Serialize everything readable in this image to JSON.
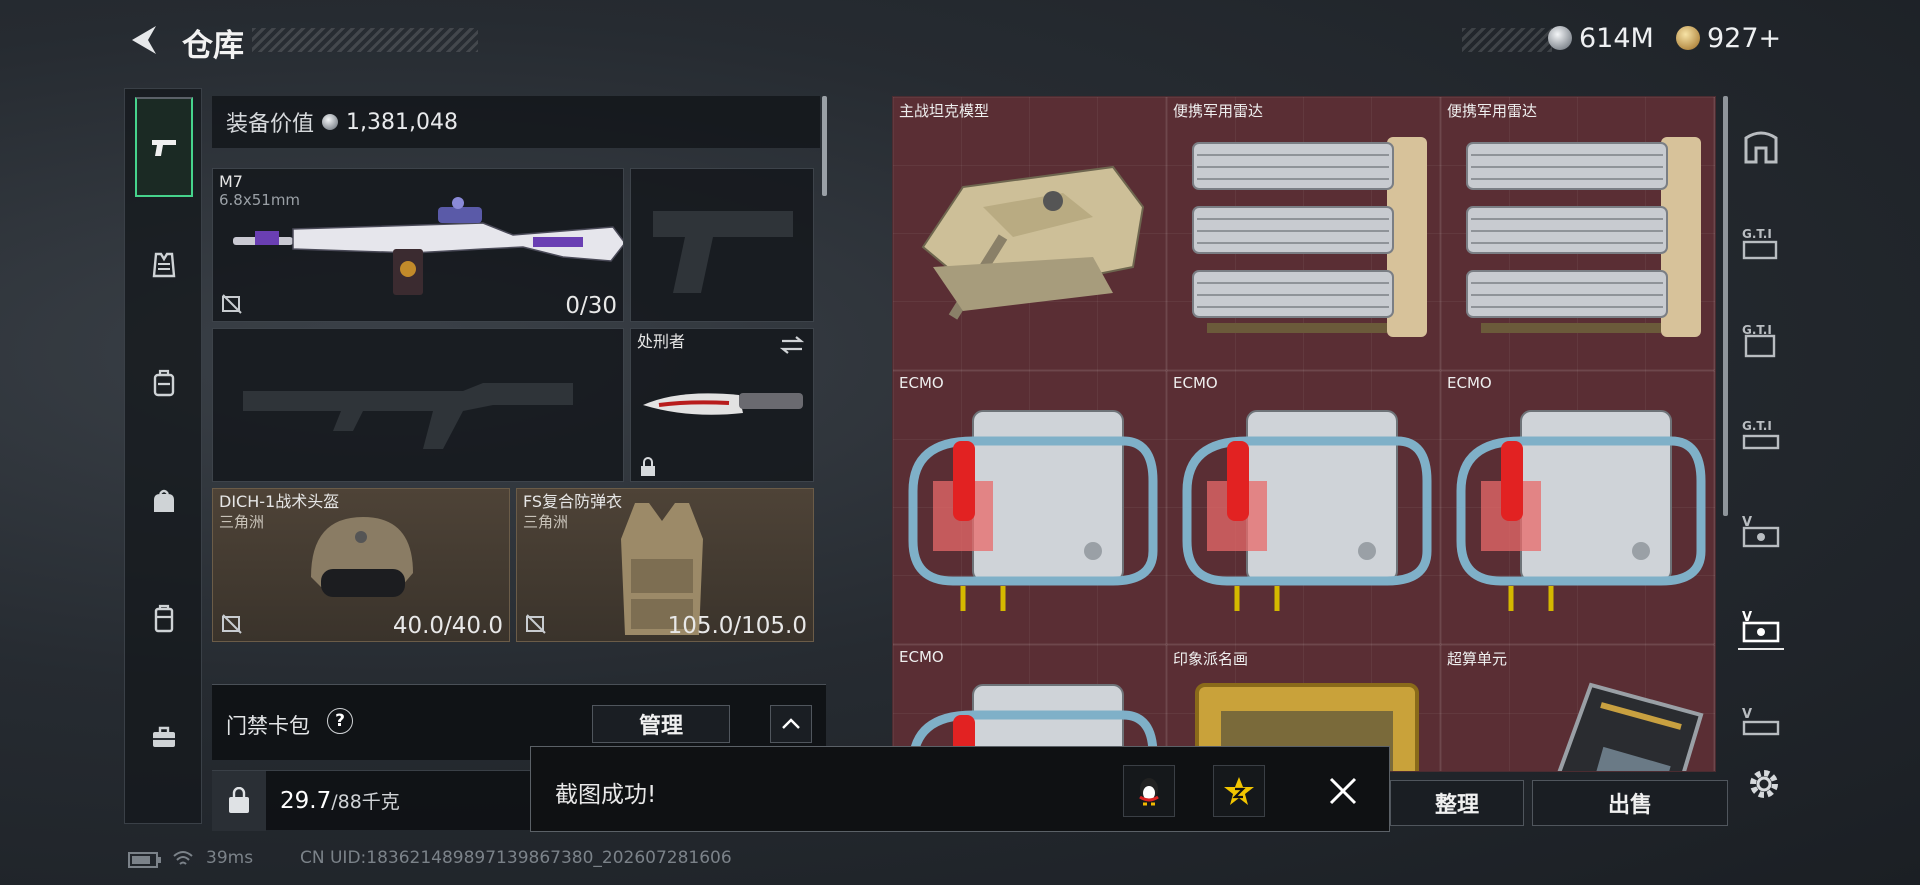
{
  "header": {
    "title": "仓库"
  },
  "currency": {
    "silver": "614M",
    "gold": "927+"
  },
  "equipment": {
    "value_label": "装备价值",
    "value": "1,381,048",
    "primary": {
      "name": "M7",
      "caliber": "6.8x51mm",
      "ammo": "0/30"
    },
    "melee": {
      "name": "处刑者"
    },
    "helmet": {
      "name": "DICH-1战术头盔",
      "faction": "三角洲",
      "durability": "40.0/40.0"
    },
    "armor": {
      "name": "FS复合防弹衣",
      "faction": "三角洲",
      "durability": "105.0/105.0"
    }
  },
  "access_card": {
    "label": "门禁卡包",
    "help": "?",
    "manage_label": "管理"
  },
  "weight": {
    "current": "29.7",
    "max": "/88千克"
  },
  "storage": {
    "items": [
      {
        "name": "主战坦克模型",
        "icon": "tank-model"
      },
      {
        "name": "便携军用雷达",
        "icon": "radar"
      },
      {
        "name": "便携军用雷达",
        "icon": "radar"
      },
      {
        "name": "ECMO",
        "icon": "ecmo"
      },
      {
        "name": "ECMO",
        "icon": "ecmo"
      },
      {
        "name": "ECMO",
        "icon": "ecmo"
      },
      {
        "name": "ECMO",
        "icon": "ecmo"
      },
      {
        "name": "印象派名画",
        "icon": "painting"
      },
      {
        "name": "超算单元",
        "icon": "supercomputer-unit"
      }
    ],
    "sort_label": "整理",
    "sell_label": "出售"
  },
  "toast": {
    "message": "截图成功!"
  },
  "status": {
    "ping": "39ms",
    "uid": "CN UID:1836214898971398673​80_202607281606"
  },
  "colors": {
    "accent_green": "#46d38c",
    "storage_bg": "#5a2e34"
  }
}
